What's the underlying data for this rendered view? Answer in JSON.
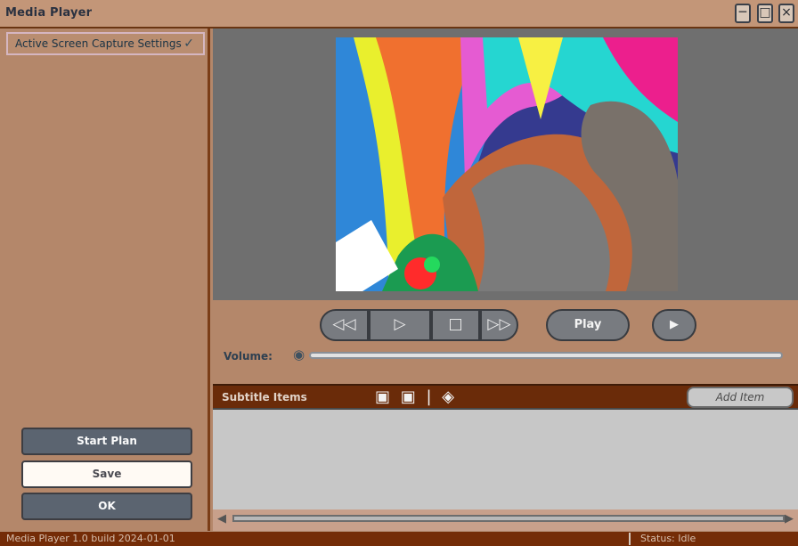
{
  "window": {
    "title": "Media Player",
    "buttons": {
      "minimize": "─",
      "maximize": "□",
      "close": "×"
    }
  },
  "sidebar": {
    "item": "Active Screen Capture Settings",
    "item_icon": "✓",
    "buttons": [
      "Start Plan",
      "Save",
      "OK"
    ]
  },
  "player": {
    "volume_label": "Volume:",
    "volume_icon": "◉",
    "volume_level": 1,
    "controls": [
      "◁◁",
      "▷",
      "□",
      "▷▷"
    ],
    "pills": [
      "Play",
      "▶"
    ]
  },
  "subtitle": {
    "title": "Subtitle Items",
    "icons": "▣ ▣ | ◈",
    "add": "Add Item"
  },
  "status": {
    "left": "Media Player 1.0 build 2024-01-01",
    "right": "Status: Idle"
  },
  "colors": {
    "accent": "#6a2b09",
    "frame": "#6f6f6f"
  }
}
